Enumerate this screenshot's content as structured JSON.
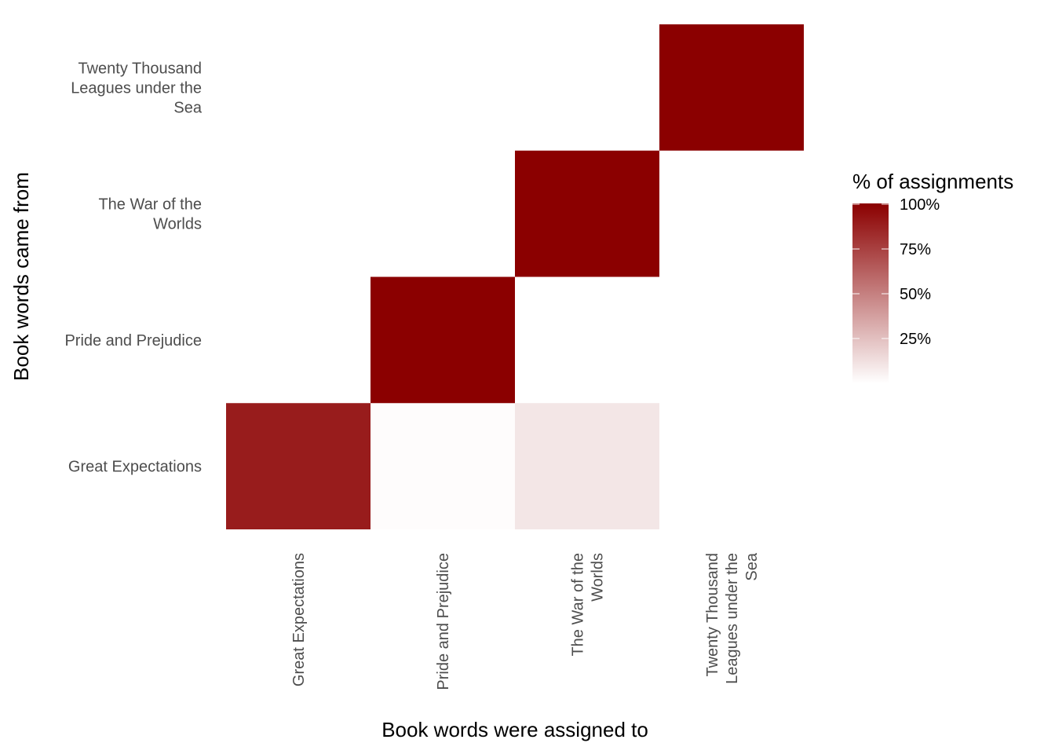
{
  "chart_data": {
    "type": "heatmap",
    "title": "",
    "xlabel": "Book words were assigned to",
    "ylabel": "Book words came from",
    "x_categories": [
      [
        "Great Expectations"
      ],
      [
        "Pride and Prejudice"
      ],
      [
        "The War of the",
        "Worlds"
      ],
      [
        "Twenty Thousand",
        "Leagues under the",
        "Sea"
      ]
    ],
    "y_categories": [
      [
        "Great Expectations"
      ],
      [
        "Pride and Prejudice"
      ],
      [
        "The War of the",
        "Worlds"
      ],
      [
        "Twenty Thousand",
        "Leagues under the",
        "Sea"
      ]
    ],
    "cells": [
      {
        "x": 0,
        "y": 0,
        "value": 0.89
      },
      {
        "x": 1,
        "y": 0,
        "value": 0.01
      },
      {
        "x": 2,
        "y": 0,
        "value": 0.1
      },
      {
        "x": 1,
        "y": 1,
        "value": 1.0
      },
      {
        "x": 2,
        "y": 2,
        "value": 1.0
      },
      {
        "x": 3,
        "y": 3,
        "value": 1.0
      }
    ],
    "color_scale": {
      "low": "#ffffff",
      "high": "#8b0000",
      "range": [
        0,
        1
      ]
    },
    "legend": {
      "title": "% of assignments",
      "position": "right",
      "breaks": [
        0.25,
        0.5,
        0.75,
        1.0
      ],
      "labels": [
        "25%",
        "50%",
        "75%",
        "100%"
      ]
    },
    "grid": false
  }
}
